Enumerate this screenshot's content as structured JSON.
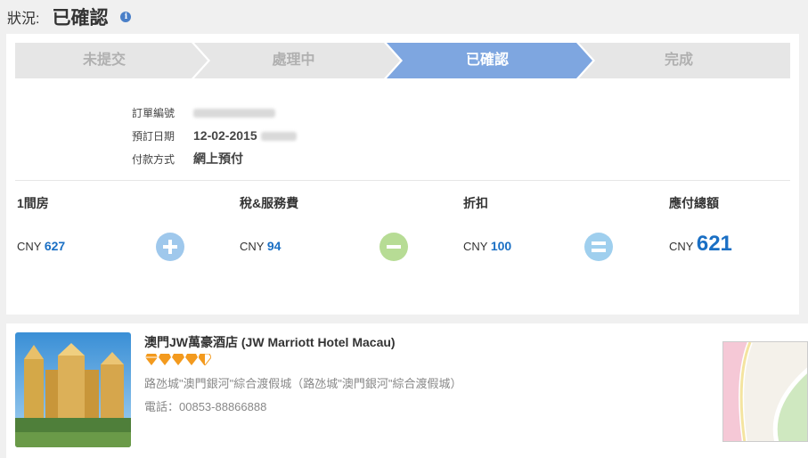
{
  "status": {
    "label": "狀況:",
    "value": "已確認",
    "info_icon": "info-icon"
  },
  "steps": [
    {
      "label": "未提交",
      "active": false
    },
    {
      "label": "處理中",
      "active": false
    },
    {
      "label": "已確認",
      "active": true
    },
    {
      "label": "完成",
      "active": false
    }
  ],
  "colors": {
    "step_active": "#7ea6e0",
    "step_inactive": "#e6e6e6",
    "price_link": "#1a6fc4",
    "diamond": "#f39a1e"
  },
  "order": {
    "number_label": "訂單編號",
    "date_label": "預訂日期",
    "date_value": "12-02-2015",
    "payment_label": "付款方式",
    "payment_value": "網上預付"
  },
  "pricing": {
    "room": {
      "title": "1間房",
      "currency": "CNY",
      "amount": "627"
    },
    "tax": {
      "title": "稅&服務費",
      "currency": "CNY",
      "amount": "94"
    },
    "discount": {
      "title": "折扣",
      "currency": "CNY",
      "amount": "100"
    },
    "total": {
      "title": "應付總額",
      "currency": "CNY",
      "amount": "621"
    },
    "operators": [
      "plus-icon",
      "minus-icon",
      "equals-icon"
    ]
  },
  "hotel": {
    "name": "澳門JW萬豪酒店 (JW Marriott Hotel Macau)",
    "rating": 4.5,
    "rating_icon": "diamond-icon",
    "address": "路氹城\"澳門銀河\"綜合渡假城（路氹城\"澳門銀河\"綜合渡假城）",
    "phone": "電話：00853-88866888"
  }
}
